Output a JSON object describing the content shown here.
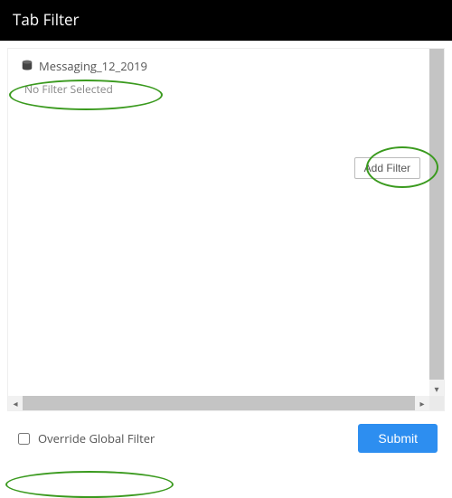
{
  "titlebar": {
    "title": "Tab Filter"
  },
  "datasource": {
    "icon": "database-icon",
    "name": "Messaging_12_2019"
  },
  "filter": {
    "empty_message": "No Filter Selected",
    "add_button_label": "Add Filter"
  },
  "footer": {
    "override_label": "Override Global Filter",
    "override_checked": false,
    "submit_label": "Submit"
  },
  "colors": {
    "accent": "#2d8ef0",
    "highlight_ring": "#3a9a1e"
  }
}
